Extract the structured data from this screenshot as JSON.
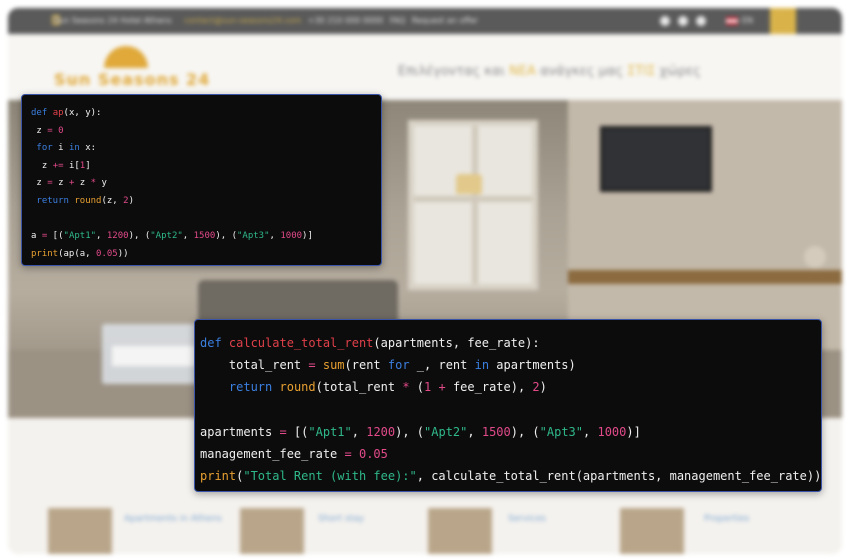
{
  "background_site": {
    "topbar_phone": "Sun Seasons 24 Hotel Athens",
    "topbar_links": [
      "contact@sun-seasons24.com",
      "+30 210 000 0000",
      "FAQ",
      "Request an offer"
    ],
    "lang_label": "EN",
    "logo_text": "Sun Seasons 24",
    "tagline_pre": "Επιλέγοντας και ",
    "tagline_hl1": "ΝΕΑ",
    "tagline_mid": " ανάγκες μας ",
    "tagline_hl2": "ΣΤΙΣ",
    "tagline_post": " χώρες",
    "card_titles": [
      "Apartments in Athens",
      "Short stay",
      "Services",
      "Properties"
    ]
  },
  "code_small": {
    "lines": [
      [
        {
          "t": "def ",
          "c": "kw"
        },
        {
          "t": "ap",
          "c": "fn"
        },
        {
          "t": "(x, y):",
          "c": ""
        }
      ],
      [
        {
          "t": " z ",
          "c": ""
        },
        {
          "t": "=",
          "c": "op"
        },
        {
          "t": " ",
          "c": ""
        },
        {
          "t": "0",
          "c": "num"
        }
      ],
      [
        {
          "t": " ",
          "c": ""
        },
        {
          "t": "for",
          "c": "kw"
        },
        {
          "t": " i ",
          "c": ""
        },
        {
          "t": "in",
          "c": "kw"
        },
        {
          "t": " x:",
          "c": ""
        }
      ],
      [
        {
          "t": "  z ",
          "c": ""
        },
        {
          "t": "+=",
          "c": "op"
        },
        {
          "t": " i[",
          "c": ""
        },
        {
          "t": "1",
          "c": "num"
        },
        {
          "t": "]",
          "c": ""
        }
      ],
      [
        {
          "t": " z ",
          "c": ""
        },
        {
          "t": "=",
          "c": "op"
        },
        {
          "t": " z ",
          "c": ""
        },
        {
          "t": "+",
          "c": "op"
        },
        {
          "t": " z ",
          "c": ""
        },
        {
          "t": "*",
          "c": "op"
        },
        {
          "t": " y",
          "c": ""
        }
      ],
      [
        {
          "t": " ",
          "c": ""
        },
        {
          "t": "return",
          "c": "kw"
        },
        {
          "t": " ",
          "c": ""
        },
        {
          "t": "round",
          "c": "bi"
        },
        {
          "t": "(z, ",
          "c": ""
        },
        {
          "t": "2",
          "c": "num"
        },
        {
          "t": ")",
          "c": ""
        }
      ],
      [],
      [
        {
          "t": "a ",
          "c": ""
        },
        {
          "t": "=",
          "c": "op"
        },
        {
          "t": " [(",
          "c": ""
        },
        {
          "t": "\"Apt1\"",
          "c": "str"
        },
        {
          "t": ", ",
          "c": ""
        },
        {
          "t": "1200",
          "c": "num"
        },
        {
          "t": "), (",
          "c": ""
        },
        {
          "t": "\"Apt2\"",
          "c": "str"
        },
        {
          "t": ", ",
          "c": ""
        },
        {
          "t": "1500",
          "c": "num"
        },
        {
          "t": "), (",
          "c": ""
        },
        {
          "t": "\"Apt3\"",
          "c": "str"
        },
        {
          "t": ", ",
          "c": ""
        },
        {
          "t": "1000",
          "c": "num"
        },
        {
          "t": ")]",
          "c": ""
        }
      ],
      [
        {
          "t": "print",
          "c": "bi"
        },
        {
          "t": "(ap(a, ",
          "c": ""
        },
        {
          "t": "0.05",
          "c": "num"
        },
        {
          "t": "))",
          "c": ""
        }
      ]
    ]
  },
  "code_large": {
    "lines": [
      [
        {
          "t": "def ",
          "c": "kw"
        },
        {
          "t": "calculate_total_rent",
          "c": "fn"
        },
        {
          "t": "(apartments, fee_rate):",
          "c": ""
        }
      ],
      [
        {
          "t": "    total_rent ",
          "c": ""
        },
        {
          "t": "=",
          "c": "op"
        },
        {
          "t": " ",
          "c": ""
        },
        {
          "t": "sum",
          "c": "bi"
        },
        {
          "t": "(rent ",
          "c": ""
        },
        {
          "t": "for",
          "c": "kw"
        },
        {
          "t": " _, rent ",
          "c": ""
        },
        {
          "t": "in",
          "c": "kw"
        },
        {
          "t": " apartments)",
          "c": ""
        }
      ],
      [
        {
          "t": "    ",
          "c": ""
        },
        {
          "t": "return",
          "c": "kw"
        },
        {
          "t": " ",
          "c": ""
        },
        {
          "t": "round",
          "c": "bi"
        },
        {
          "t": "(total_rent ",
          "c": ""
        },
        {
          "t": "*",
          "c": "op"
        },
        {
          "t": " (",
          "c": ""
        },
        {
          "t": "1",
          "c": "num"
        },
        {
          "t": " ",
          "c": ""
        },
        {
          "t": "+",
          "c": "op"
        },
        {
          "t": " fee_rate), ",
          "c": ""
        },
        {
          "t": "2",
          "c": "num"
        },
        {
          "t": ")",
          "c": ""
        }
      ],
      [],
      [
        {
          "t": "apartments ",
          "c": ""
        },
        {
          "t": "=",
          "c": "op"
        },
        {
          "t": " [(",
          "c": ""
        },
        {
          "t": "\"Apt1\"",
          "c": "str"
        },
        {
          "t": ", ",
          "c": ""
        },
        {
          "t": "1200",
          "c": "num"
        },
        {
          "t": "), (",
          "c": ""
        },
        {
          "t": "\"Apt2\"",
          "c": "str"
        },
        {
          "t": ", ",
          "c": ""
        },
        {
          "t": "1500",
          "c": "num"
        },
        {
          "t": "), (",
          "c": ""
        },
        {
          "t": "\"Apt3\"",
          "c": "str"
        },
        {
          "t": ", ",
          "c": ""
        },
        {
          "t": "1000",
          "c": "num"
        },
        {
          "t": ")]",
          "c": ""
        }
      ],
      [
        {
          "t": "management_fee_rate ",
          "c": ""
        },
        {
          "t": "=",
          "c": "op"
        },
        {
          "t": " ",
          "c": ""
        },
        {
          "t": "0.05",
          "c": "num"
        }
      ],
      [
        {
          "t": "print",
          "c": "bi"
        },
        {
          "t": "(",
          "c": ""
        },
        {
          "t": "\"Total Rent (with fee):\"",
          "c": "str"
        },
        {
          "t": ", calculate_total_rent(apartments, management_fee_rate))",
          "c": ""
        }
      ]
    ]
  },
  "colors": {
    "keyword": "#3b7fe0",
    "function_name": "#e0404a",
    "builtin": "#e8a030",
    "string": "#2fb88a",
    "number": "#e24a8a",
    "panel_bg": "#0c0c0c",
    "panel_border": "#3a55a8"
  }
}
